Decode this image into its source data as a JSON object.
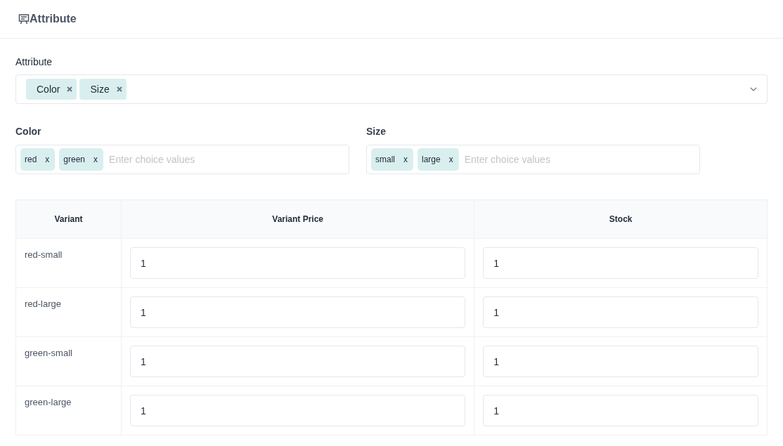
{
  "header": {
    "title": "Attribute"
  },
  "attribute_select": {
    "label": "Attribute",
    "tags": [
      "Color",
      "Size"
    ]
  },
  "choice_fields": [
    {
      "label": "Color",
      "placeholder": "Enter choice values",
      "tags": [
        {
          "text": "red",
          "remove": "x"
        },
        {
          "text": "green",
          "remove": "x"
        }
      ]
    },
    {
      "label": "Size",
      "placeholder": "Enter choice values",
      "tags": [
        {
          "text": "small",
          "remove": "x"
        },
        {
          "text": "large",
          "remove": "x"
        }
      ]
    }
  ],
  "table": {
    "columns": [
      "Variant",
      "Variant Price",
      "Stock"
    ],
    "rows": [
      {
        "variant": "red-small",
        "price": "1",
        "stock": "1"
      },
      {
        "variant": "red-large",
        "price": "1",
        "stock": "1"
      },
      {
        "variant": "green-small",
        "price": "1",
        "stock": "1"
      },
      {
        "variant": "green-large",
        "price": "1",
        "stock": "1"
      }
    ]
  }
}
